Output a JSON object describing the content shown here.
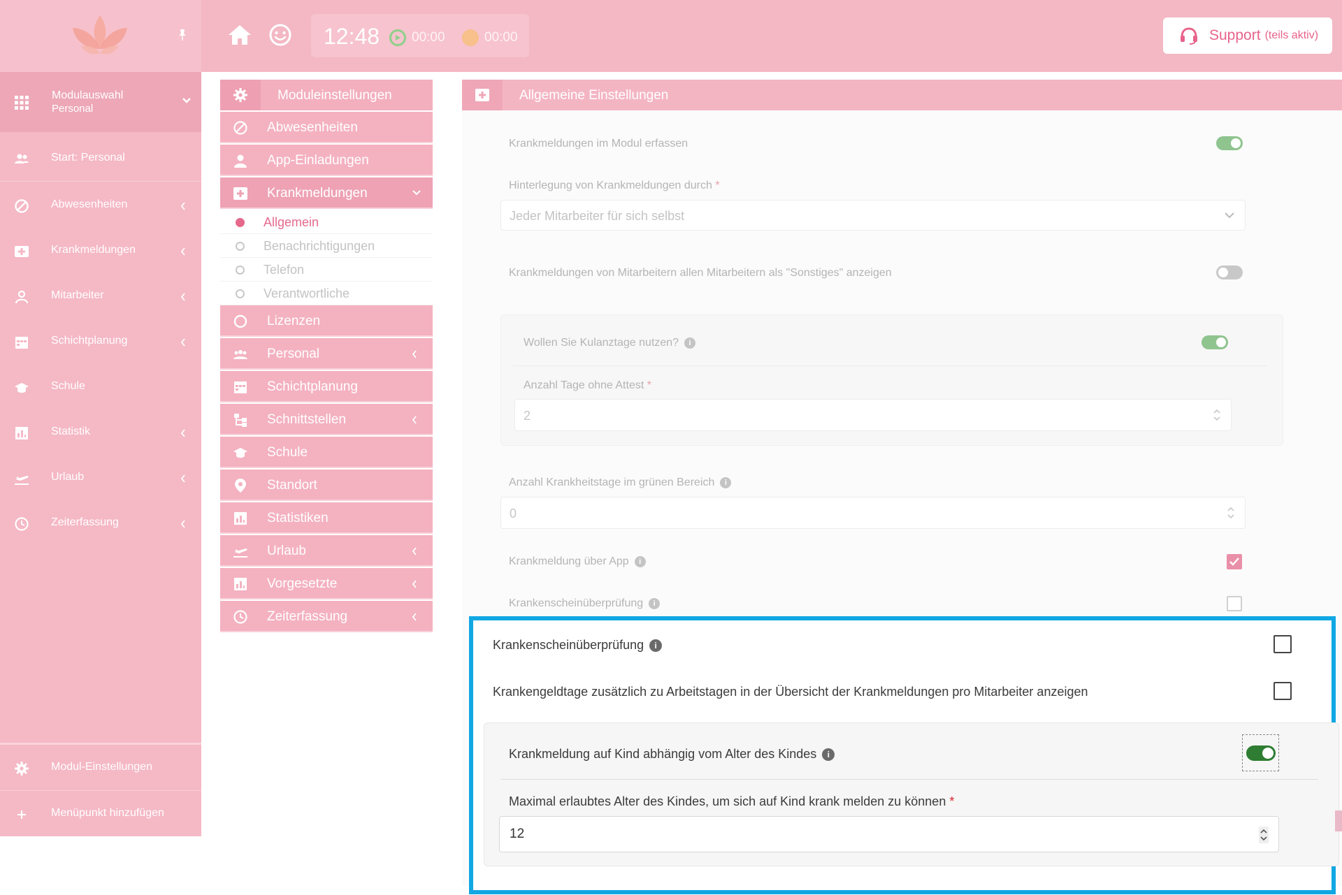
{
  "topbar": {
    "clock": "12:48",
    "timer_green": "00:00",
    "timer_orange": "00:00",
    "support_label": "Support",
    "support_sub": "(teils aktiv)",
    "colors": {
      "topbar": "#f3b8c4",
      "accent": "#e8638a"
    }
  },
  "sidebar": {
    "header_title": "Modulauswahl",
    "header_sub": "Personal",
    "items": [
      {
        "label": "Start: Personal",
        "icon": "users-icon",
        "has_chevron": false
      },
      {
        "label": "Abwesenheiten",
        "icon": "ban-icon",
        "has_chevron": true
      },
      {
        "label": "Krankmeldungen",
        "icon": "medical-cross-icon",
        "has_chevron": true
      },
      {
        "label": "Mitarbeiter",
        "icon": "user-icon",
        "has_chevron": true
      },
      {
        "label": "Schichtplanung",
        "icon": "calendar-icon",
        "has_chevron": true
      },
      {
        "label": "Schule",
        "icon": "graduation-cap-icon",
        "has_chevron": false
      },
      {
        "label": "Statistik",
        "icon": "chart-icon",
        "has_chevron": true
      },
      {
        "label": "Urlaub",
        "icon": "plane-icon",
        "has_chevron": true
      },
      {
        "label": "Zeiterfassung",
        "icon": "clock-icon",
        "has_chevron": true
      }
    ],
    "bottom": [
      {
        "label": "Modul-Einstellungen",
        "icon": "gear-icon"
      },
      {
        "label": "Menüpunkt hinzufügen",
        "icon": "plus-icon"
      }
    ]
  },
  "module_menu": {
    "header": "Moduleinstellungen",
    "items": [
      {
        "label": "Abwesenheiten",
        "icon": "ban-icon",
        "has_chevron": false
      },
      {
        "label": "App-Einladungen",
        "icon": "user-icon",
        "has_chevron": false
      },
      {
        "label": "Krankmeldungen",
        "icon": "medical-cross-icon",
        "has_chevron": true,
        "expanded": true
      }
    ],
    "subitems": [
      {
        "label": "Allgemein",
        "active": true
      },
      {
        "label": "Benachrichtigungen",
        "active": false
      },
      {
        "label": "Telefon",
        "active": false
      },
      {
        "label": "Verantwortliche",
        "active": false
      }
    ],
    "items_after": [
      {
        "label": "Lizenzen",
        "icon": "circle-icon",
        "has_chevron": false
      },
      {
        "label": "Personal",
        "icon": "users-icon",
        "has_chevron": true
      },
      {
        "label": "Schichtplanung",
        "icon": "calendar-icon",
        "has_chevron": false
      },
      {
        "label": "Schnittstellen",
        "icon": "sitemap-icon",
        "has_chevron": true
      },
      {
        "label": "Schule",
        "icon": "graduation-cap-icon",
        "has_chevron": false
      },
      {
        "label": "Standort",
        "icon": "map-pin-icon",
        "has_chevron": false
      },
      {
        "label": "Statistiken",
        "icon": "chart-icon",
        "has_chevron": false
      },
      {
        "label": "Urlaub",
        "icon": "plane-icon",
        "has_chevron": true
      },
      {
        "label": "Vorgesetzte",
        "icon": "chart-icon",
        "has_chevron": true
      },
      {
        "label": "Zeiterfassung",
        "icon": "clock-icon",
        "has_chevron": true
      }
    ]
  },
  "settings": {
    "header": "Allgemeine Einstellungen",
    "erfassen_label": "Krankmeldungen im Modul erfassen",
    "erfassen_on": true,
    "hinterlegung_label": "Hinterlegung von Krankmeldungen durch",
    "hinterlegung_value": "Jeder Mitarbeiter für sich selbst",
    "sonstiges_label": "Krankmeldungen von Mitarbeitern allen Mitarbeitern als \"Sonstiges\" anzeigen",
    "sonstiges_on": false,
    "kulanz_label": "Wollen Sie Kulanztage nutzen?",
    "kulanz_on": true,
    "tage_ohne_attest_label": "Anzahl Tage ohne Attest",
    "tage_ohne_attest_value": "2",
    "gruen_label": "Anzahl Krankheitstage im grünen Bereich",
    "gruen_value": "0",
    "app_label": "Krankmeldung über App",
    "app_checked": true,
    "pruefung_label": "Krankenscheinüberprüfung",
    "pruefung_checked": false,
    "required_mark": "*"
  },
  "highlight": {
    "pruefung_label": "Krankenscheinüberprüfung",
    "pruefung_checked": false,
    "krankengeld_label": "Krankengeldtage zusätzlich zu Arbeitstagen in der Übersicht der Krankmeldungen pro Mitarbeiter anzeigen",
    "krankengeld_checked": false,
    "kind_label": "Krankmeldung auf Kind abhängig vom Alter des Kindes",
    "kind_on": true,
    "max_alter_label": "Maximal erlaubtes Alter des Kindes, um sich auf Kind krank melden zu können",
    "max_alter_value": "12",
    "required_mark": "*",
    "border_color": "#10a7e3"
  }
}
